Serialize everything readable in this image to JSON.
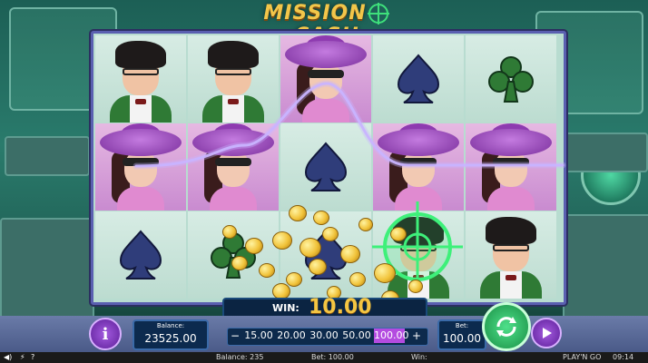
{
  "logo": {
    "left": "MISSION",
    "right": "CASH"
  },
  "reels": [
    [
      "nerd",
      "hat-lady",
      "spade"
    ],
    [
      "nerd",
      "hat-lady",
      "club"
    ],
    [
      "hat-lady",
      "spade",
      "spade"
    ],
    [
      "spade",
      "hat-lady",
      "nerd"
    ],
    [
      "club",
      "hat-lady",
      "nerd"
    ]
  ],
  "colors": {
    "spade": "#2f3d7a",
    "club": "#2f7a35",
    "winline": "#c9b4ff",
    "crosshair": "#3ef07a"
  },
  "win": {
    "label": "WIN:",
    "value": "10.00"
  },
  "balance": {
    "label": "Balance:",
    "value": "23525.00"
  },
  "bet_options": {
    "minus": "−",
    "plus": "+",
    "items": [
      "15.00",
      "20.00",
      "30.00",
      "50.00",
      "100.00"
    ],
    "selected": "100.00"
  },
  "bet": {
    "label": "Bet:",
    "value": "100.00"
  },
  "status_bar": {
    "balance": "Balance: 235",
    "bet": "Bet: 100.00",
    "win": "Win:",
    "time": "09:14",
    "brand": "PLAY'N GO"
  }
}
